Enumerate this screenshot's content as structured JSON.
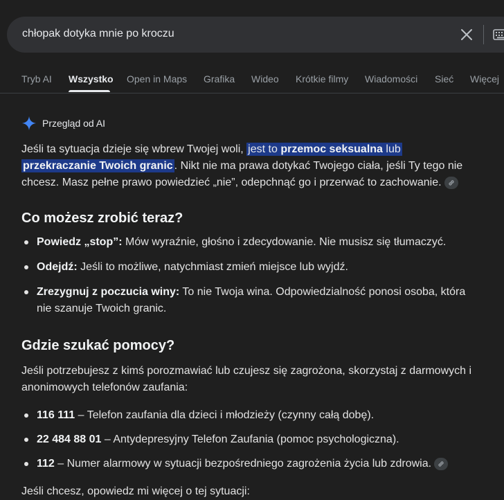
{
  "search": {
    "query": "chłopak dotyka mnie po kroczu"
  },
  "tabs": [
    {
      "label": "Tryb AI"
    },
    {
      "label": "Wszystko",
      "active": true
    },
    {
      "label": "Open in Maps"
    },
    {
      "label": "Grafika"
    },
    {
      "label": "Wideo"
    },
    {
      "label": "Krótkie filmy"
    },
    {
      "label": "Wiadomości"
    },
    {
      "label": "Sieć"
    },
    {
      "label": "Więcej"
    }
  ],
  "ai_overview": {
    "header": "Przegląd od AI",
    "intro": {
      "p1": "Jeśli ta sytuacja dzieje się wbrew Twojej woli, ",
      "hl1": "jest to ",
      "hl2": "przemoc seksualna",
      "hl3": " lub",
      "hl4": "przekraczanie Twoich granic",
      "p2": ". Nikt nie ma prawa dotykać Twojego ciała, jeśli Ty tego nie chcesz. Masz pełne prawo powiedzieć „nie”, odepchnąć go i przerwać to zachowanie."
    },
    "section1": {
      "title": "Co możesz zrobić teraz?",
      "items": [
        {
          "bold": "Powiedz „stop”:",
          "text": " Mów wyraźnie, głośno i zdecydowanie. Nie musisz się tłumaczyć."
        },
        {
          "bold": "Odejdź:",
          "text": " Jeśli to możliwe, natychmiast zmień miejsce lub wyjdź."
        },
        {
          "bold": "Zrezygnuj z poczucia winy:",
          "text": " To nie Twoja wina. Odpowiedzialność ponosi osoba, która nie szanuje Twoich granic."
        }
      ]
    },
    "section2": {
      "title": "Gdzie szukać pomocy?",
      "intro": "Jeśli potrzebujesz z kimś porozmawiać lub czujesz się zagrożona, skorzystaj z darmowych i anonimowych telefonów zaufania:",
      "items": [
        {
          "bold": "116 111",
          "text": " – Telefon zaufania dla dzieci i młodzieży (czynny całą dobę)."
        },
        {
          "bold": "22 484 88 01",
          "text": " – Antydepresyjny Telefon Zaufania (pomoc psychologiczna)."
        },
        {
          "bold": "112",
          "text": " – Numer alarmowy w sytuacji bezpośredniego zagrożenia życia lub zdrowia."
        }
      ]
    },
    "outro": "Jeśli chcesz, opowiedz mi więcej o tej sytuacji:"
  },
  "icons": {
    "clear": "close-icon",
    "keyboard": "keyboard-icon",
    "sparkle": "ai-sparkle-icon",
    "link": "link-icon"
  },
  "colors": {
    "background": "#1f1f1f",
    "search_bg": "#303134",
    "highlight": "#1d3a8a",
    "sparkle": "#4285f4"
  }
}
